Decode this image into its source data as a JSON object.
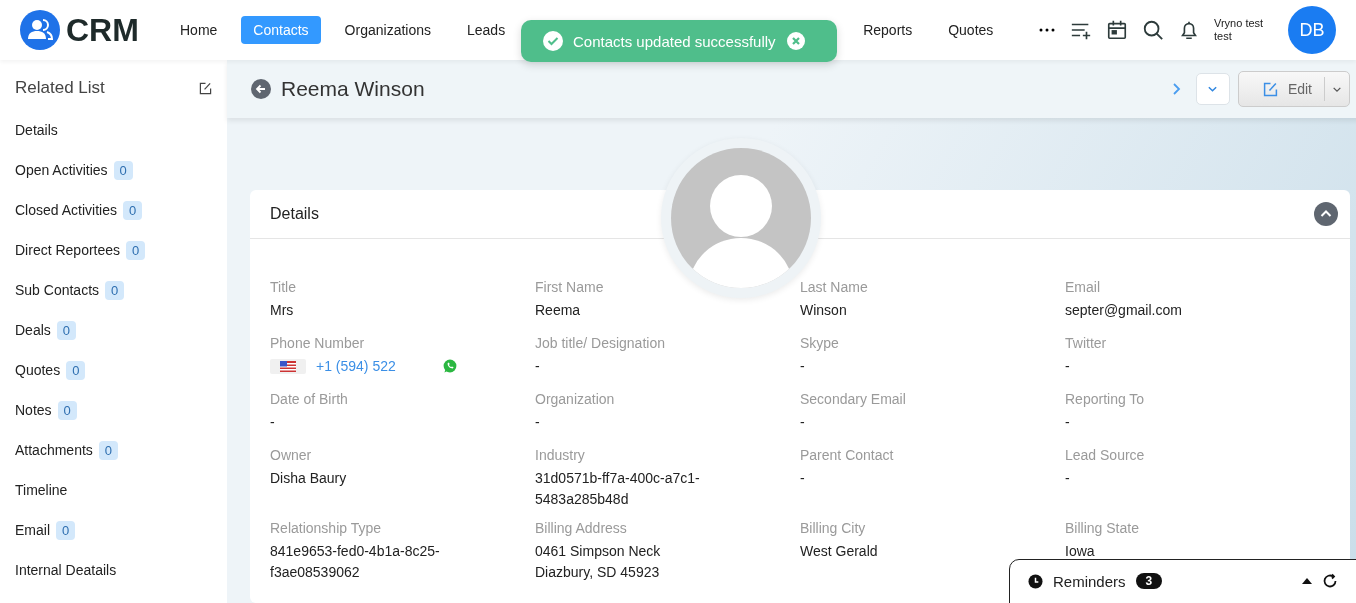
{
  "app": {
    "logo": "CRM"
  },
  "nav": [
    {
      "label": "Home",
      "selected": false
    },
    {
      "label": "Contacts",
      "selected": true
    },
    {
      "label": "Organizations",
      "selected": false
    },
    {
      "label": "Leads",
      "selected": false
    },
    {
      "label": "Reports",
      "selected": false
    },
    {
      "label": "Quotes",
      "selected": false
    }
  ],
  "user": {
    "name": "Vryno test test",
    "initials": "DB"
  },
  "toast": {
    "message": "Contacts updated successfully"
  },
  "sidebar": {
    "title": "Related List",
    "items": [
      {
        "label": "Details"
      },
      {
        "label": "Open Activities",
        "count": "0"
      },
      {
        "label": "Closed Activities",
        "count": "0"
      },
      {
        "label": "Direct Reportees",
        "count": "0"
      },
      {
        "label": "Sub Contacts",
        "count": "0"
      },
      {
        "label": "Deals",
        "count": "0"
      },
      {
        "label": "Quotes",
        "count": "0"
      },
      {
        "label": "Notes",
        "count": "0"
      },
      {
        "label": "Attachments",
        "count": "0"
      },
      {
        "label": "Timeline"
      },
      {
        "label": "Email",
        "count": "0"
      },
      {
        "label": "Internal Deatails"
      }
    ]
  },
  "record": {
    "name": "Reema Winson",
    "edit_label": "Edit"
  },
  "details": {
    "title": "Details",
    "fields": [
      {
        "kind": "text",
        "label": "Title",
        "value": "Mrs"
      },
      {
        "kind": "text",
        "label": "First Name",
        "value": "Reema"
      },
      {
        "kind": "text",
        "label": "Last Name",
        "value": "Winson"
      },
      {
        "kind": "text",
        "label": "Email",
        "value": "septer@gmail.com"
      },
      {
        "kind": "phone",
        "label": "Phone Number",
        "value": "+1 (594) 522"
      },
      {
        "kind": "text",
        "label": "Job title/ Designation",
        "value": "-"
      },
      {
        "kind": "text",
        "label": "Skype",
        "value": "-"
      },
      {
        "kind": "text",
        "label": "Twitter",
        "value": "-"
      },
      {
        "kind": "text",
        "label": "Date of Birth",
        "value": "-"
      },
      {
        "kind": "text",
        "label": "Organization",
        "value": "-"
      },
      {
        "kind": "text",
        "label": "Secondary Email",
        "value": "-"
      },
      {
        "kind": "text",
        "label": "Reporting To",
        "value": "-"
      },
      {
        "kind": "text",
        "label": "Owner",
        "value": "Disha Baury"
      },
      {
        "kind": "text",
        "label": "Industry",
        "value": "31d0571b-ff7a-400c-a7c1-5483a285b48d"
      },
      {
        "kind": "text",
        "label": "Parent Contact",
        "value": "-"
      },
      {
        "kind": "text",
        "label": "Lead Source",
        "value": "-"
      },
      {
        "kind": "text",
        "label": "Relationship Type",
        "value": "841e9653-fed0-4b1a-8c25-f3ae08539062"
      },
      {
        "kind": "address",
        "label": "Billing Address",
        "lines": [
          "0461 Simpson Neck",
          "Diazbury, SD 45923"
        ]
      },
      {
        "kind": "text",
        "label": "Billing City",
        "value": "West Gerald"
      },
      {
        "kind": "text",
        "label": "Billing State",
        "value": "Iowa"
      }
    ]
  },
  "reminders": {
    "label": "Reminders",
    "count": "3"
  }
}
